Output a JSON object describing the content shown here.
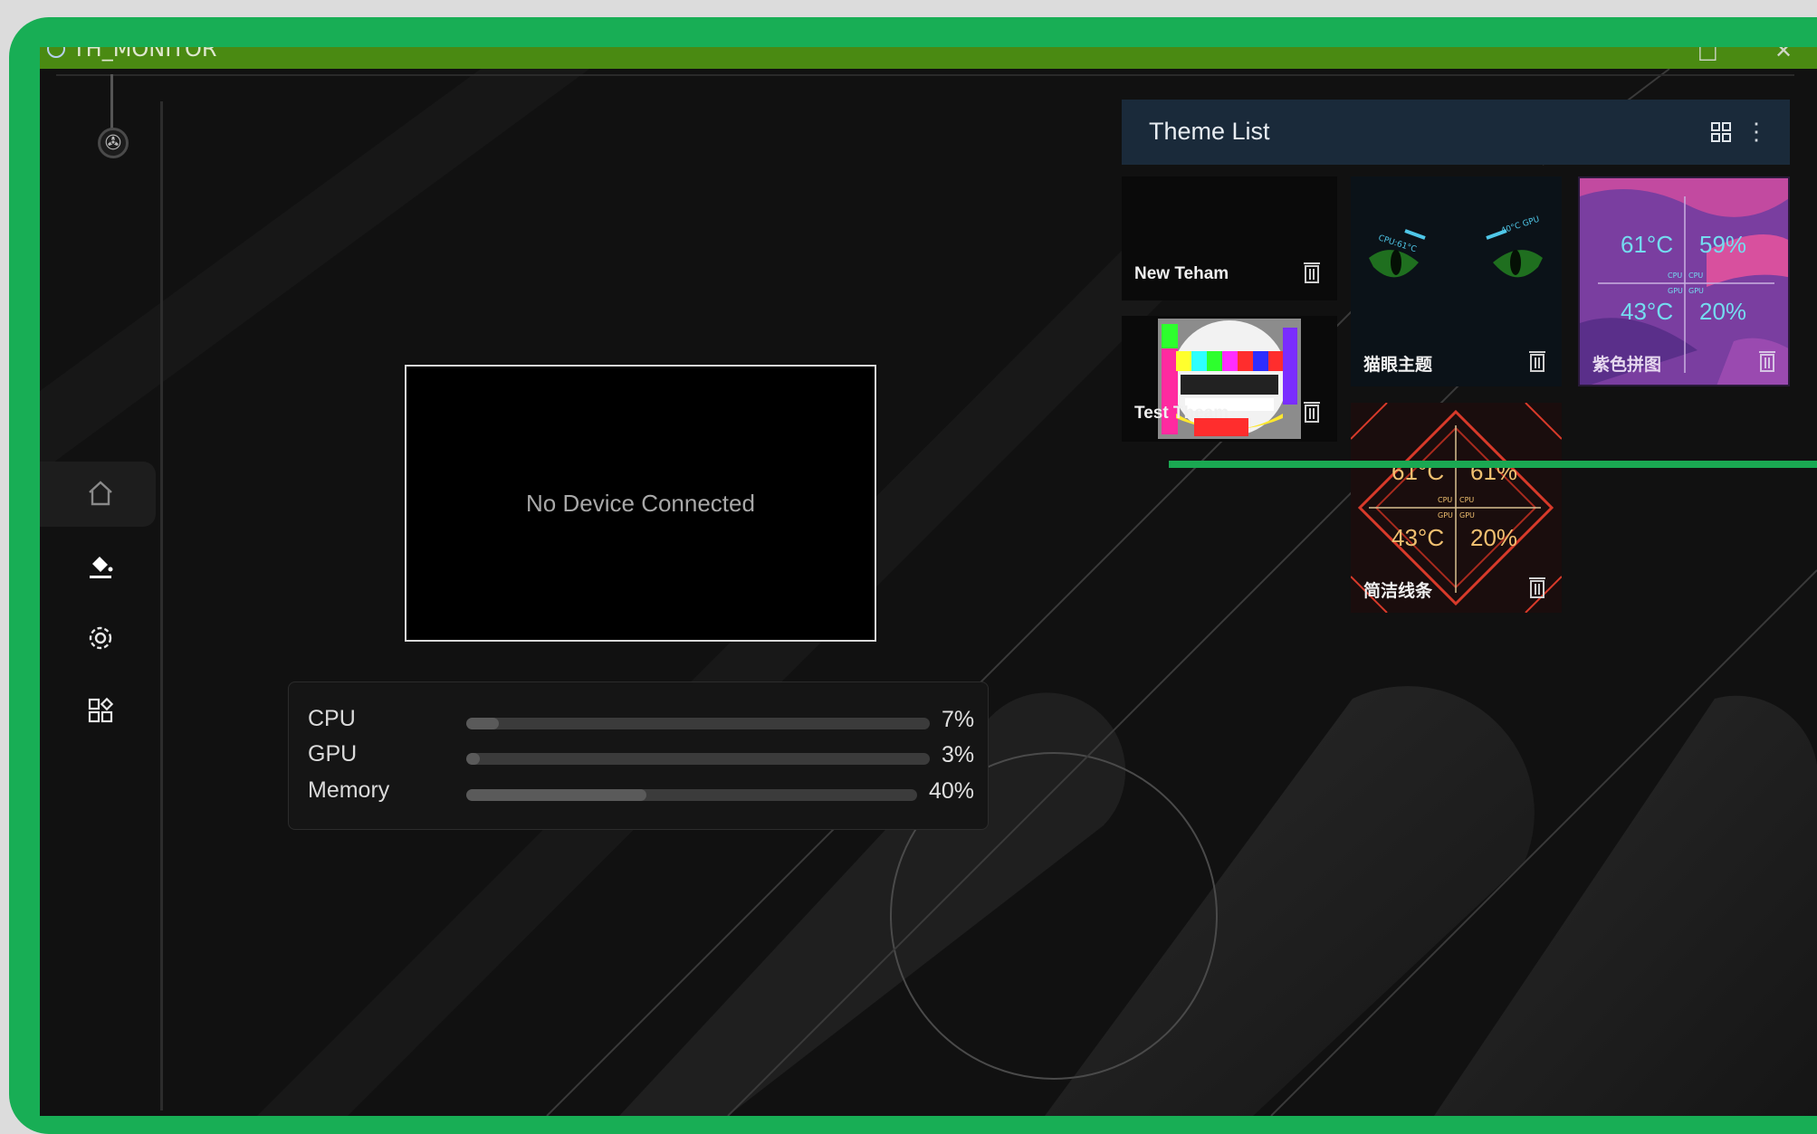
{
  "app": {
    "title": "TH_MONITOR"
  },
  "sidebar": {
    "logo": "fan-logo-icon",
    "items": [
      {
        "name": "home",
        "icon": "home-icon",
        "active": true
      },
      {
        "name": "theme",
        "icon": "paint-bucket-icon",
        "active": false
      },
      {
        "name": "settings",
        "icon": "gear-icon",
        "active": false
      },
      {
        "name": "apps",
        "icon": "apps-icon",
        "active": false
      }
    ]
  },
  "preview": {
    "message": "No Device Connected"
  },
  "stats": [
    {
      "label": "CPU",
      "value": "7%",
      "percent": 7
    },
    {
      "label": "GPU",
      "value": "3%",
      "percent": 3
    },
    {
      "label": "Memory",
      "value": "40%",
      "percent": 40
    }
  ],
  "theme_list": {
    "title": "Theme List",
    "view_icon": "grid-view-icon",
    "menu_icon": "more-vertical-icon",
    "themes": [
      {
        "name": "New Teham"
      },
      {
        "name": "Test Theam"
      },
      {
        "name": "猫眼主题",
        "cpu_label": "CPU:61°C",
        "gpu_label": "40°C GPU"
      },
      {
        "name": "紫色拼图",
        "cpu_temp": "61°C",
        "cpu_use": "59%",
        "gpu_temp": "43°C",
        "gpu_use": "20%",
        "cpu": "CPU",
        "gpu": "GPU"
      },
      {
        "name": "简洁线条",
        "cpu_temp": "61°C",
        "cpu_use": "61%",
        "gpu_temp": "43°C",
        "gpu_use": "20%",
        "cpu": "CPU",
        "gpu": "GPU"
      }
    ]
  },
  "colors": {
    "frame": "#18ae55",
    "titlebar": "#4a8a12",
    "theme_header": "#1a2a3a",
    "purple_theme": "#7a3ea0",
    "red_theme": "#d83a2a"
  }
}
